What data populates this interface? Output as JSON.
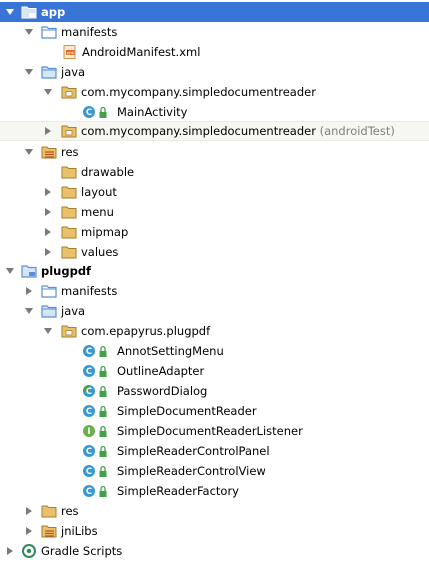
{
  "tree": {
    "rows": [
      {
        "label": "app"
      },
      {
        "label": "manifests"
      },
      {
        "label": "AndroidManifest.xml"
      },
      {
        "label": "java"
      },
      {
        "label": "com.mycompany.simpledocumentreader"
      },
      {
        "label": "MainActivity"
      },
      {
        "label": "com.mycompany.simpledocumentreader",
        "suffix": "(androidTest)"
      },
      {
        "label": "res"
      },
      {
        "label": "drawable"
      },
      {
        "label": "layout"
      },
      {
        "label": "menu"
      },
      {
        "label": "mipmap"
      },
      {
        "label": "values"
      },
      {
        "label": "plugpdf"
      },
      {
        "label": "manifests"
      },
      {
        "label": "java"
      },
      {
        "label": "com.epapyrus.plugpdf"
      },
      {
        "label": "AnnotSettingMenu"
      },
      {
        "label": "OutlineAdapter"
      },
      {
        "label": "PasswordDialog"
      },
      {
        "label": "SimpleDocumentReader"
      },
      {
        "label": "SimpleDocumentReaderListener"
      },
      {
        "label": "SimpleReaderControlPanel"
      },
      {
        "label": "SimpleReaderControlView"
      },
      {
        "label": "SimpleReaderFactory"
      },
      {
        "label": "res"
      },
      {
        "label": "jniLibs"
      },
      {
        "label": "Gradle Scripts"
      }
    ]
  },
  "colors": {
    "selection": "#3875d7",
    "folder": "#c69c4b",
    "source_folder": "#5b8fd6",
    "class_icon": "#3a97d6",
    "interface_icon": "#6ab04c",
    "lock_badge": "#42a047",
    "suffix_text": "#808080"
  },
  "icons": {
    "arrow_expanded": "triangle-down-icon",
    "arrow_collapsed": "triangle-right-icon",
    "module": "module-folder-icon",
    "folder": "folder-icon",
    "source_folder": "source-folder-icon",
    "resources_folder": "resources-folder-icon",
    "package": "package-icon",
    "class": "class-c-icon",
    "interface": "interface-i-icon",
    "xml": "xml-file-icon",
    "gradle": "gradle-icon"
  }
}
